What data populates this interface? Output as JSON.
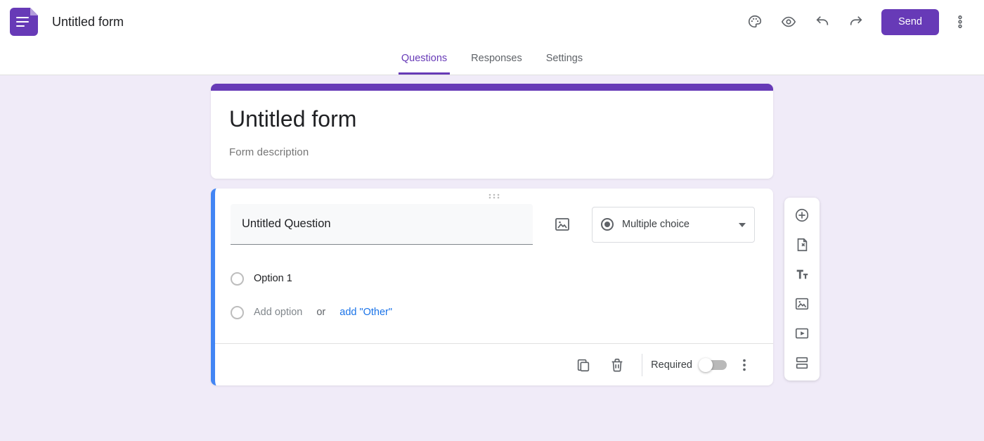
{
  "header": {
    "title": "Untitled form",
    "send": "Send"
  },
  "tabs": {
    "questions": "Questions",
    "responses": "Responses",
    "settings": "Settings"
  },
  "form": {
    "title": "Untitled form",
    "description_placeholder": "Form description"
  },
  "question": {
    "title": "Untitled Question",
    "type": "Multiple choice",
    "option1": "Option 1",
    "add_option": "Add option",
    "or": "or",
    "add_other": "add \"Other\"",
    "required": "Required"
  }
}
